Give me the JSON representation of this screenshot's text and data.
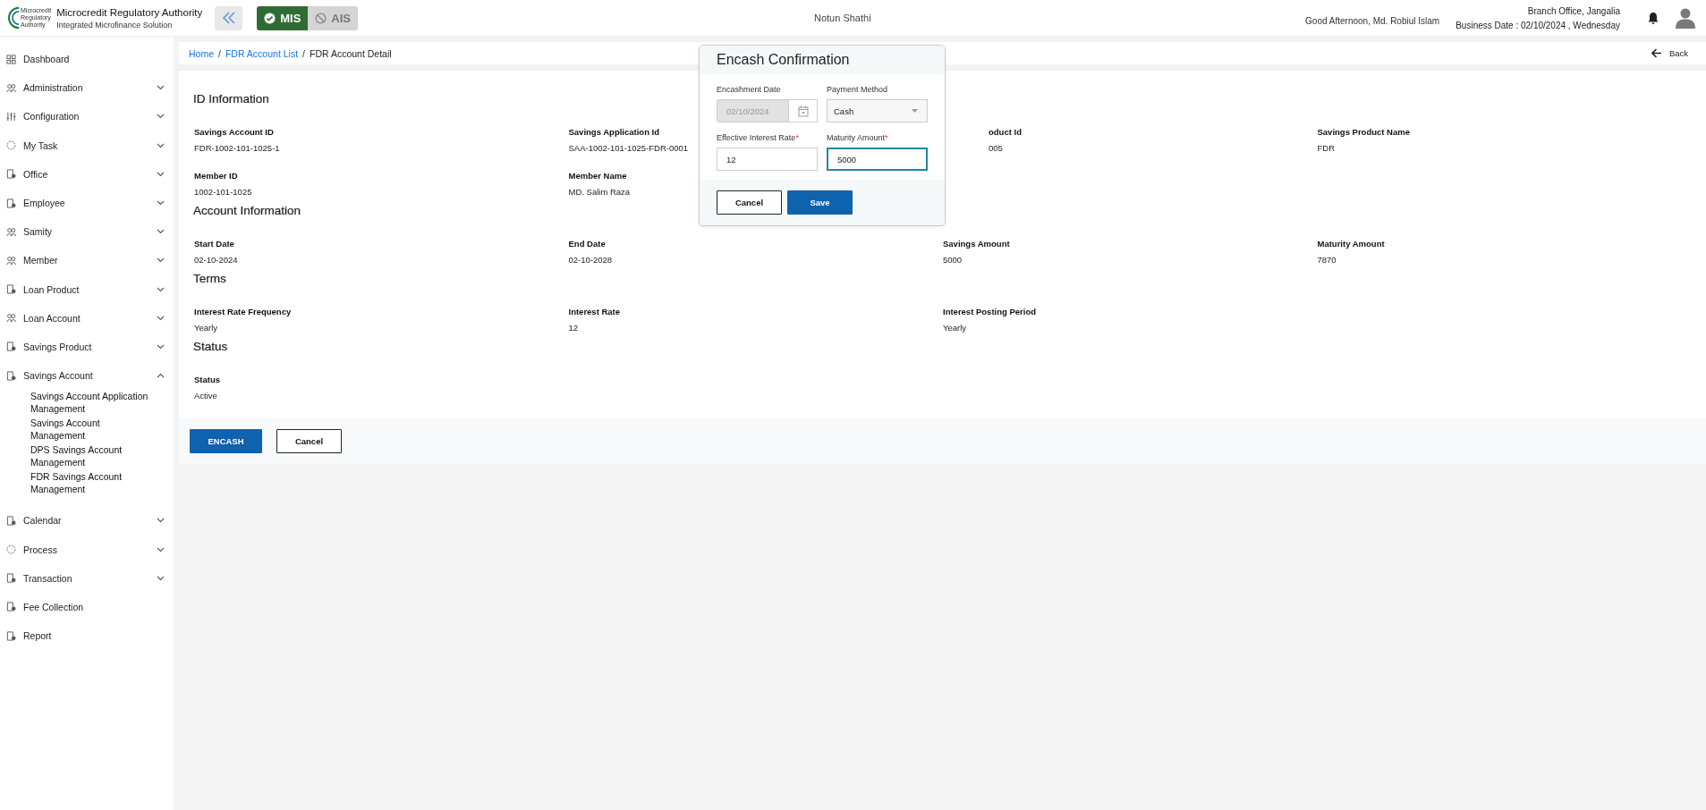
{
  "header": {
    "logo_text": [
      "Microcredit",
      "Regulatory",
      "Authority"
    ],
    "title": "Microcredit Regulatory Authority",
    "subtitle": "Integrated Microfinance Solution",
    "modules": [
      {
        "label": "MIS",
        "selected": true
      },
      {
        "label": "AIS",
        "selected": false
      }
    ],
    "center_title": "Notun Shathi",
    "greeting": "Good Afternoon, Md. Robiul Islam",
    "branch": "Branch Office, Jangalia",
    "business_date": "Business Date : 02/10/2024 , Wednesday"
  },
  "sidebar": {
    "items": [
      {
        "label": "Dashboard",
        "kind": "link"
      },
      {
        "label": "Administration",
        "kind": "group",
        "expanded": false
      },
      {
        "label": "Configuration",
        "kind": "group",
        "expanded": false
      },
      {
        "label": "My Task",
        "kind": "group",
        "expanded": false
      },
      {
        "label": "Office",
        "kind": "group",
        "expanded": false
      },
      {
        "label": "Employee",
        "kind": "group",
        "expanded": false
      },
      {
        "label": "Samity",
        "kind": "group",
        "expanded": false
      },
      {
        "label": "Member",
        "kind": "group",
        "expanded": false
      },
      {
        "label": "Loan Product",
        "kind": "group",
        "expanded": false
      },
      {
        "label": "Loan Account",
        "kind": "group",
        "expanded": false
      },
      {
        "label": "Savings Product",
        "kind": "group",
        "expanded": false
      },
      {
        "label": "Savings Account",
        "kind": "group",
        "expanded": true,
        "children": [
          "Savings Account Application Management",
          "Savings Account Management",
          "DPS Savings Account Management",
          "FDR Savings Account Management"
        ]
      },
      {
        "label": "Calendar",
        "kind": "group",
        "expanded": false
      },
      {
        "label": "Process",
        "kind": "group",
        "expanded": false
      },
      {
        "label": "Transaction",
        "kind": "group",
        "expanded": false
      },
      {
        "label": "Fee Collection",
        "kind": "link"
      },
      {
        "label": "Report",
        "kind": "link"
      }
    ]
  },
  "breadcrumb_separator": "/",
  "breadcrumb": [
    {
      "label": "Home",
      "kind": "link"
    },
    {
      "label": "FDR Account List",
      "kind": "link"
    },
    {
      "label": "FDR Account Detail",
      "kind": "current"
    }
  ],
  "back": "Back",
  "sections": [
    {
      "title": "ID Information",
      "fields": [
        {
          "label": "Savings Account ID",
          "value": "FDR-1002-101-1025-1",
          "cut": false
        },
        {
          "label": "Savings Application Id",
          "value": "SAA-1002-101-1025-FDR-0001",
          "cut": false
        },
        {
          "label": "oduct Id",
          "value": "005",
          "cut": true
        },
        {
          "label": "Savings Product Name",
          "value": "FDR",
          "cut": false
        },
        {
          "label": "Member ID",
          "value": "1002-101-1025",
          "cut": false
        },
        {
          "label": "Member Name",
          "value": "MD. Salim Raza",
          "cut": false
        }
      ]
    },
    {
      "title": "Account Information",
      "fields": [
        {
          "label": "Start Date",
          "value": "02-10-2024",
          "cut": false
        },
        {
          "label": "End Date",
          "value": "02-10-2028",
          "cut": false
        },
        {
          "label": "Savings Amount",
          "value": "5000",
          "cut": false
        },
        {
          "label": "Maturity Amount",
          "value": "7870",
          "cut": false
        }
      ]
    },
    {
      "title": "Terms",
      "fields": [
        {
          "label": "Interest Rate Frequency",
          "value": "Yearly",
          "cut": false
        },
        {
          "label": "Interest Rate",
          "value": "12",
          "cut": false
        },
        {
          "label": "Interest Posting Period",
          "value": "Yearly",
          "cut": false
        }
      ]
    },
    {
      "title": "Status",
      "fields": [
        {
          "label": "Status",
          "value": "Active",
          "cut": false
        }
      ]
    }
  ],
  "actions": [
    {
      "label": "ENCASH",
      "kind": "primary"
    },
    {
      "label": "Cancel",
      "kind": "secondary"
    }
  ],
  "modal": {
    "title": "Encash Confirmation",
    "required_mark": "*",
    "fields": [
      {
        "label": "Encashment Date",
        "kind": "date",
        "value": "02/10/2024",
        "disabled": true,
        "required": false,
        "focused": false
      },
      {
        "label": "Payment Method",
        "kind": "select",
        "value": "Cash",
        "disabled": false,
        "required": false,
        "focused": false
      },
      {
        "label": "Effective Interest Rate",
        "kind": "text",
        "value": "12",
        "disabled": false,
        "required": true,
        "focused": false
      },
      {
        "label": "Maturity Amount",
        "kind": "text",
        "value": "5000",
        "disabled": false,
        "required": true,
        "focused": true
      }
    ],
    "buttons": [
      {
        "label": "Cancel",
        "kind": "secondary"
      },
      {
        "label": "Save",
        "kind": "primary"
      }
    ]
  }
}
